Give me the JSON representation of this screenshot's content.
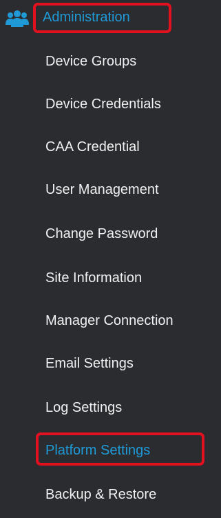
{
  "section": {
    "label": "Administration",
    "icon": "users-icon",
    "accent_color": "#1f9ad6"
  },
  "nav_items": [
    {
      "label": "Device Groups",
      "active": false
    },
    {
      "label": "Device Credentials",
      "active": false
    },
    {
      "label": "CAA Credential",
      "active": false
    },
    {
      "label": "User Management",
      "active": false
    },
    {
      "label": "Change Password",
      "active": false
    },
    {
      "label": "Site Information",
      "active": false
    },
    {
      "label": "Manager Connection",
      "active": false
    },
    {
      "label": "Email Settings",
      "active": false
    },
    {
      "label": "Log Settings",
      "active": false
    },
    {
      "label": "Platform Settings",
      "active": true
    },
    {
      "label": "Backup & Restore",
      "active": false
    }
  ],
  "highlight_color": "#e3101f"
}
